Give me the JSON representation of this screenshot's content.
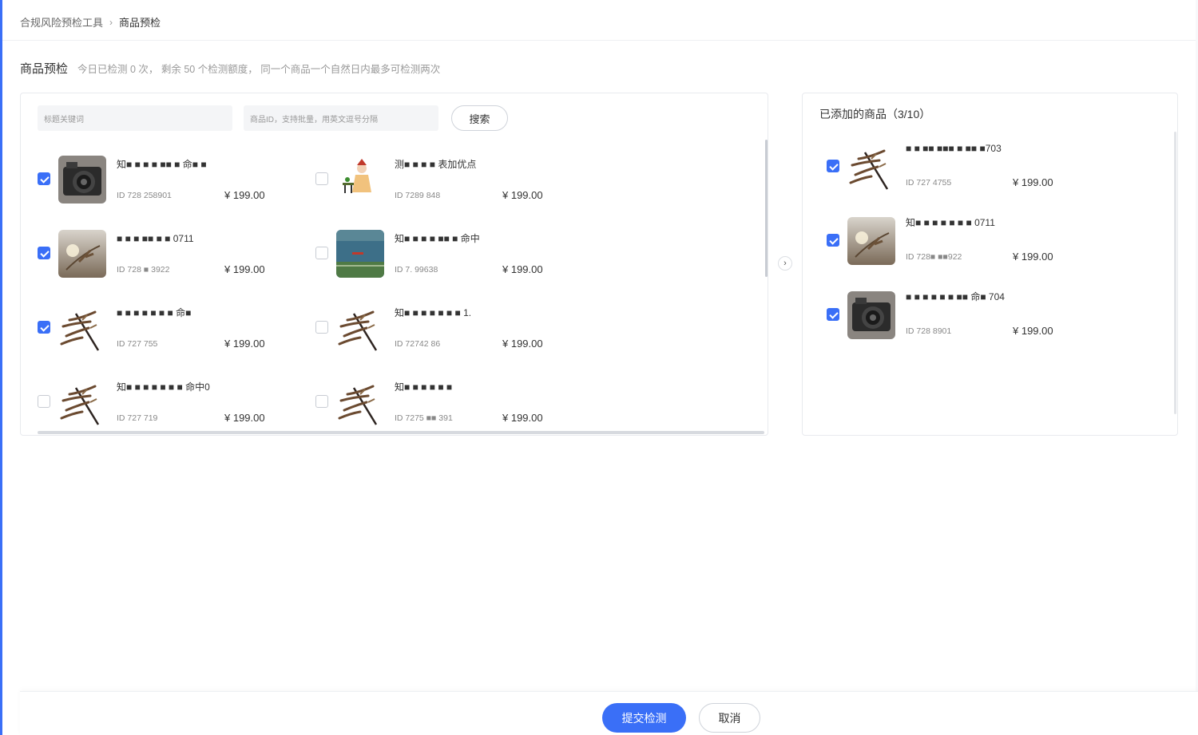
{
  "breadcrumb": {
    "root": "合规风险预检工具",
    "separator": "›",
    "current": "商品预检"
  },
  "heading": {
    "title": "商品预检",
    "hint": "今日已检测 0 次，  剩余 50 个检测额度，  同一个商品一个自然日内最多可检测两次"
  },
  "search": {
    "keyword_placeholder": "标题关键词",
    "ids_placeholder": "商品ID，支持批量，用英文逗号分隔",
    "button_label": "搜索"
  },
  "products": [
    {
      "checked": true,
      "image": "camera",
      "name": "知■ ■ ■ ■ ■■ ■ 命■ ■",
      "id_text": "ID  728     258901",
      "price": "¥ 199.00"
    },
    {
      "checked": false,
      "image": "girl",
      "name": "测■ ■ ■ ■ 表加优点",
      "id_text": "ID  7289       848",
      "price": "¥ 199.00"
    },
    {
      "checked": true,
      "image": "wheat",
      "name": "■ ■ ■ ■■ ■ ■ 0711",
      "id_text": "ID  728  ■  3922",
      "price": "¥ 199.00"
    },
    {
      "checked": false,
      "image": "lake",
      "name": "知■ ■ ■ ■ ■■ ■ 命中",
      "id_text": "ID  7.       99638",
      "price": "¥ 199.00"
    },
    {
      "checked": true,
      "image": "branch",
      "name": "■ ■ ■ ■ ■ ■ ■ 命■",
      "id_text": "ID  727      755",
      "price": "¥ 199.00"
    },
    {
      "checked": false,
      "image": "branch",
      "name": "知■ ■ ■ ■ ■ ■ ■ 1.",
      "id_text": "ID  72742    86",
      "price": "¥ 199.00"
    },
    {
      "checked": false,
      "image": "branch",
      "name": "知■ ■ ■ ■ ■ ■ ■ 命中0",
      "id_text": "ID  727      719",
      "price": "¥ 199.00"
    },
    {
      "checked": false,
      "image": "branch",
      "name": "知■ ■ ■ ■ ■ ■",
      "id_text": "ID  7275  ■■  391",
      "price": "¥ 199.00"
    }
  ],
  "added": {
    "title": "已添加的商品（3/10）",
    "items": [
      {
        "checked": true,
        "image": "branch",
        "name": "■ ■ ■■ ■■■ ■ ■■ ■703",
        "id_text": "ID  727      4755",
        "price": "¥ 199.00"
      },
      {
        "checked": true,
        "image": "wheat",
        "name": "知■ ■ ■ ■ ■ ■ ■ 0711",
        "id_text": "ID  728■  ■■922",
        "price": "¥ 199.00"
      },
      {
        "checked": true,
        "image": "camera",
        "name": "■ ■ ■ ■ ■ ■ ■■ 命■ 704",
        "id_text": "ID  728      8901",
        "price": "¥ 199.00"
      }
    ]
  },
  "footer": {
    "submit_label": "提交检测",
    "cancel_label": "取消"
  },
  "colors": {
    "accent": "#3a6ff7",
    "text": "#333333",
    "muted": "#999999"
  }
}
